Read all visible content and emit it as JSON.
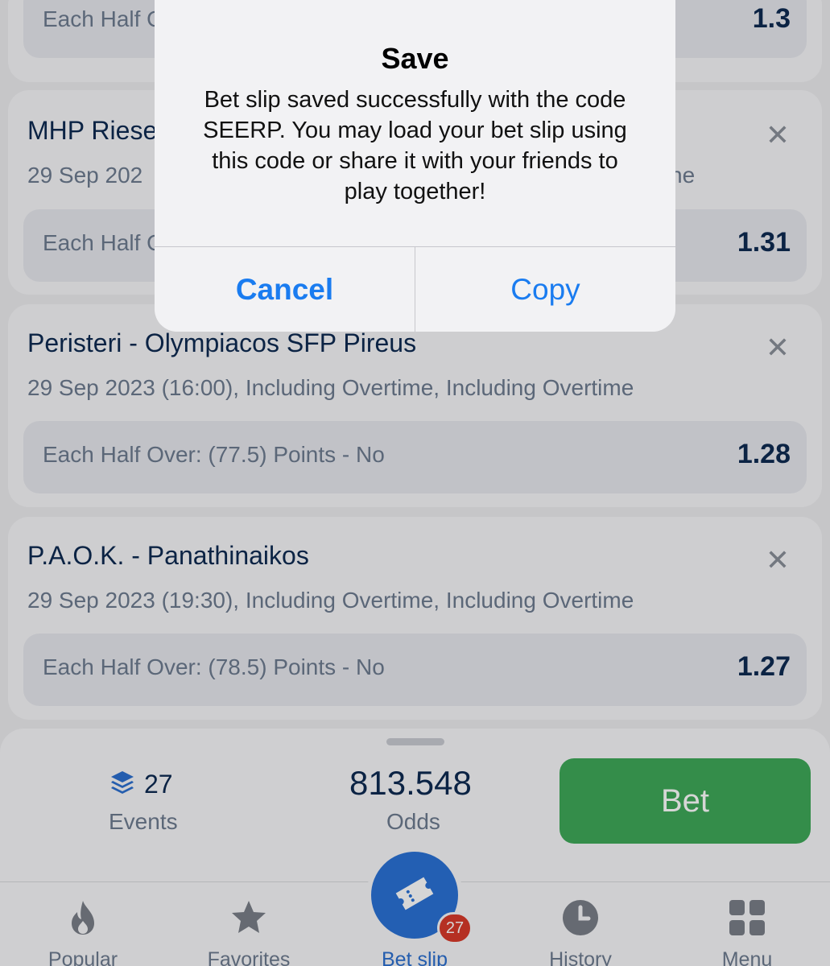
{
  "bets": [
    {
      "title": "",
      "date": "",
      "selection": "Each Half O",
      "odd": "1.3"
    },
    {
      "title": "MHP Riese",
      "date": "29 Sep 202",
      "date_tail": "ne",
      "selection": "Each Half O",
      "odd": "1.31"
    },
    {
      "title": "Peristeri - Olympiacos SFP Pireus",
      "date": "29 Sep 2023 (16:00), Including Overtime, Including Overtime",
      "selection": "Each Half Over: (77.5) Points - No",
      "odd": "1.28"
    },
    {
      "title": "P.A.O.K. - Panathinaikos",
      "date": "29 Sep 2023 (19:30), Including Overtime, Including Overtime",
      "selection": "Each Half Over: (78.5) Points - No",
      "odd": "1.27"
    }
  ],
  "close_glyph": "✕",
  "summary": {
    "events_count": "27",
    "events_label": "Events",
    "odds_value": "813.548",
    "odds_label": "Odds",
    "bet_label": "Bet"
  },
  "tabs": [
    {
      "label": "Popular",
      "icon": "flame-icon"
    },
    {
      "label": "Favorites",
      "icon": "star-icon"
    },
    {
      "label": "Bet slip",
      "icon": "ticket-icon",
      "active": true
    },
    {
      "label": "History",
      "icon": "clock-icon"
    },
    {
      "label": "Menu",
      "icon": "grid-icon"
    }
  ],
  "betslip_badge": "27",
  "dialog": {
    "title": "Save",
    "message": "Bet slip saved successfully with the code SEERP. You may load your bet slip using this code or share it with your friends to play together!",
    "cancel_label": "Cancel",
    "copy_label": "Copy"
  },
  "colors": {
    "accent_blue": "#2a72d6",
    "bet_green": "#3fa959",
    "badge_red": "#d83a2a",
    "text_navy": "#0e2a52"
  }
}
